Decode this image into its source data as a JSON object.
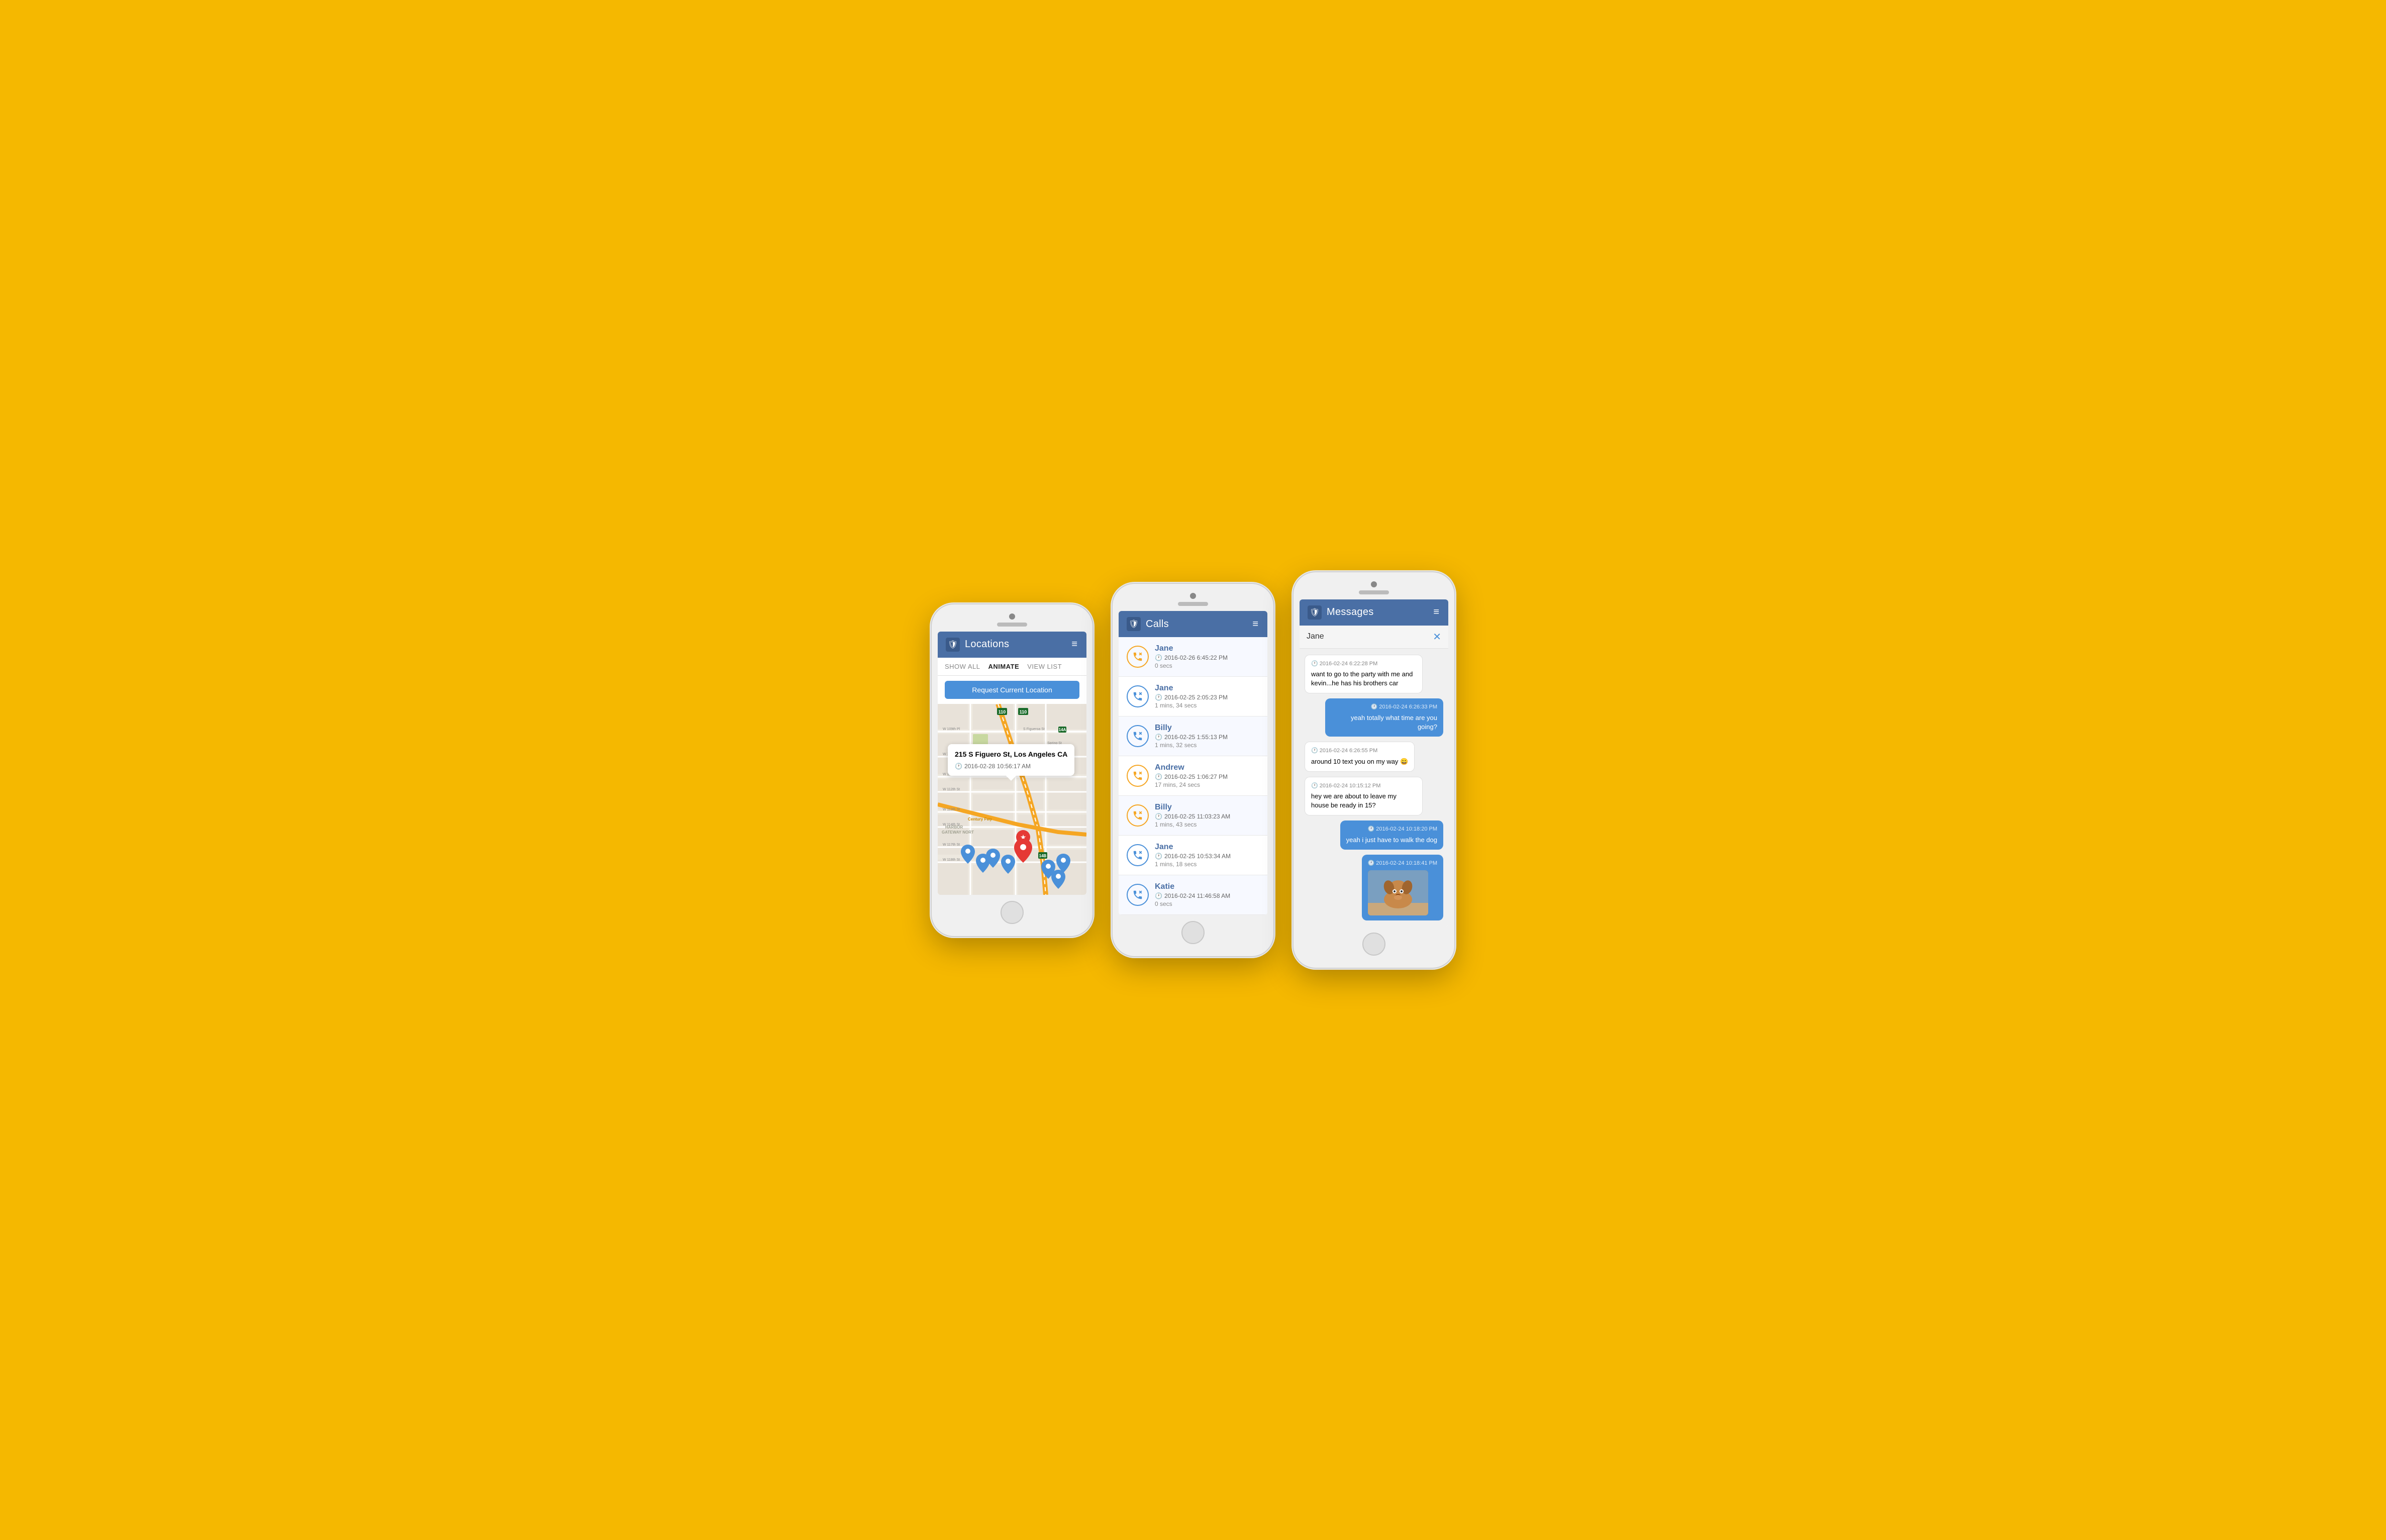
{
  "phones": [
    {
      "id": "locations",
      "header": {
        "title": "Locations",
        "logo_symbol": "🛡"
      },
      "toolbar": {
        "items": [
          {
            "label": "SHOW ALL",
            "active": false
          },
          {
            "label": "ANIMATE",
            "active": true
          },
          {
            "label": "VIEW LIST",
            "active": false
          }
        ],
        "request_btn": "Request Current Location"
      },
      "map": {
        "popup_address": "215 S Figuero St, Los Angeles CA",
        "popup_time": "2016-02-28 10:56:17 AM"
      }
    },
    {
      "id": "calls",
      "header": {
        "title": "Calls",
        "logo_symbol": "🛡"
      },
      "calls": [
        {
          "name": "Jane",
          "time": "2016-02-26 6:45:22 PM",
          "duration": "0 secs",
          "type": "outgoing"
        },
        {
          "name": "Jane",
          "time": "2016-02-25 2:05:23 PM",
          "duration": "1 mins, 34 secs",
          "type": "incoming"
        },
        {
          "name": "Billy",
          "time": "2016-02-25 1:55:13 PM",
          "duration": "1 mins, 32 secs",
          "type": "incoming"
        },
        {
          "name": "Andrew",
          "time": "2016-02-25 1:06:27 PM",
          "duration": "17 mins, 24 secs",
          "type": "outgoing"
        },
        {
          "name": "Billy",
          "time": "2016-02-25 11:03:23 AM",
          "duration": "1 mins, 43 secs",
          "type": "outgoing"
        },
        {
          "name": "Jane",
          "time": "2016-02-25 10:53:34 AM",
          "duration": "1 mins, 18 secs",
          "type": "incoming"
        },
        {
          "name": "Katie",
          "time": "2016-02-24 11:46:58 AM",
          "duration": "0 secs",
          "type": "incoming"
        }
      ]
    },
    {
      "id": "messages",
      "header": {
        "title": "Messages",
        "logo_symbol": "🛡"
      },
      "contact": "Jane",
      "messages": [
        {
          "type": "incoming",
          "time": "2016-02-24 6:22:28 PM",
          "text": "want to go to the party with me and kevin...he has his brothers car",
          "has_image": false
        },
        {
          "type": "outgoing",
          "time": "2016-02-24 6:26:33 PM",
          "text": "yeah totally what time are you going?",
          "has_image": false
        },
        {
          "type": "incoming",
          "time": "2016-02-24 6:26:55 PM",
          "text": "around 10 text you on my way 😀",
          "has_image": false
        },
        {
          "type": "incoming",
          "time": "2016-02-24 10:15:12 PM",
          "text": "hey we are about to leave my house be ready in 15?",
          "has_image": false
        },
        {
          "type": "outgoing",
          "time": "2016-02-24 10:18:20 PM",
          "text": "yeah i just have to walk the dog",
          "has_image": false
        },
        {
          "type": "outgoing",
          "time": "2016-02-24 10:18:41 PM",
          "text": "",
          "has_image": true
        }
      ]
    }
  ]
}
